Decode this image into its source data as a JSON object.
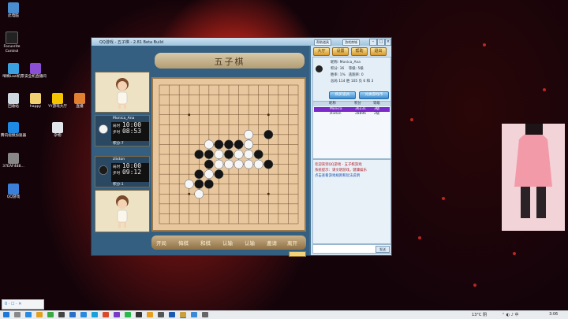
{
  "desktop_icons": [
    {
      "label": "此电脑"
    },
    {
      "label": "Focusrite Control"
    },
    {
      "label": "嘀嘀Lazi机票"
    },
    {
      "label": "安全机直播间"
    },
    {
      "label": "回收站"
    },
    {
      "label": "happy"
    },
    {
      "label": "YY游戏大厅"
    },
    {
      "label": "直播"
    },
    {
      "label": "腾讯视频加速器"
    },
    {
      "label": "杂物"
    },
    {
      "label": "37EAF488..."
    },
    {
      "label": "QQ游戏"
    }
  ],
  "window": {
    "title": "QQ游戏 - 五子棋 - 2.81 Beta Build",
    "top_buttons": [
      "帮助道具",
      "游戏商城"
    ],
    "banner": "五子棋"
  },
  "players": {
    "top": {
      "name": "Monica_Ana",
      "time_label": "局时",
      "time1": "10:00",
      "step_label": "步时",
      "time2": "08:53",
      "score_label": "积分",
      "score": "7"
    },
    "bottom": {
      "name": "zlixton",
      "time_label": "局时",
      "time1": "10:00",
      "step_label": "步时",
      "time2": "09:12",
      "score_label": "积分",
      "score": "1"
    }
  },
  "board": {
    "size": 15,
    "black": [
      [
        11,
        5
      ],
      [
        6,
        6
      ],
      [
        7,
        6
      ],
      [
        8,
        6
      ],
      [
        9,
        6
      ],
      [
        4,
        7
      ],
      [
        5,
        7
      ],
      [
        7,
        7
      ],
      [
        10,
        7
      ],
      [
        5,
        8
      ],
      [
        11,
        8
      ],
      [
        4,
        9
      ],
      [
        6,
        9
      ],
      [
        4,
        10
      ],
      [
        5,
        10
      ]
    ],
    "white": [
      [
        9,
        5
      ],
      [
        5,
        6
      ],
      [
        9,
        6
      ],
      [
        6,
        7
      ],
      [
        8,
        7
      ],
      [
        9,
        7
      ],
      [
        6,
        8
      ],
      [
        7,
        8
      ],
      [
        8,
        8
      ],
      [
        9,
        8
      ],
      [
        10,
        8
      ],
      [
        5,
        9
      ],
      [
        3,
        10
      ],
      [
        4,
        11
      ]
    ],
    "star_points": [
      [
        3,
        3
      ],
      [
        11,
        3
      ],
      [
        7,
        7
      ],
      [
        3,
        11
      ],
      [
        11,
        11
      ]
    ]
  },
  "bottom_bar": [
    "开局",
    "悔棋",
    "和棋",
    "认输",
    "认输",
    "邀请",
    "离开"
  ],
  "right_panel": {
    "tabs": [
      "大厅",
      "设置",
      "帮助",
      "退出"
    ],
    "user": {
      "nickname_label": "昵称",
      "nickname": "Monica_Ana",
      "score_label": "积分",
      "score": "36",
      "level_label": "等级",
      "level": "5级",
      "win_label": "胜率",
      "win": "1%",
      "escape_label": "逃跑率",
      "escape": "0",
      "total_label": "总局",
      "total": "114",
      "win_count_label": "胜",
      "win_count": "105",
      "loss_label": "负",
      "loss": "6",
      "draw_label": "和",
      "draw": "3"
    },
    "buttons": [
      "购买道具",
      "兑换游戏币"
    ],
    "list_headers": [
      "昵称",
      "积分",
      "等级"
    ],
    "list": [
      {
        "name": "Monica",
        "score": "36231",
        "level": "3级"
      },
      {
        "name": "zlixton",
        "score": "28896",
        "level": "2级"
      }
    ],
    "chat": [
      "欢迎来到QQ游戏 - 五子棋游戏",
      "系统提示：请文明游戏，健康娱乐",
      "点击查看游戏规则和玩法说明"
    ],
    "bottom_button": "发送"
  },
  "taskbar": {
    "weather": "13°C 阴",
    "time": "3:06",
    "notification": "0 · ☐ · ✕"
  },
  "colors": {
    "board": "#e8c79e",
    "window": "#3e6f90",
    "accent_tab": "#d89a2c"
  }
}
